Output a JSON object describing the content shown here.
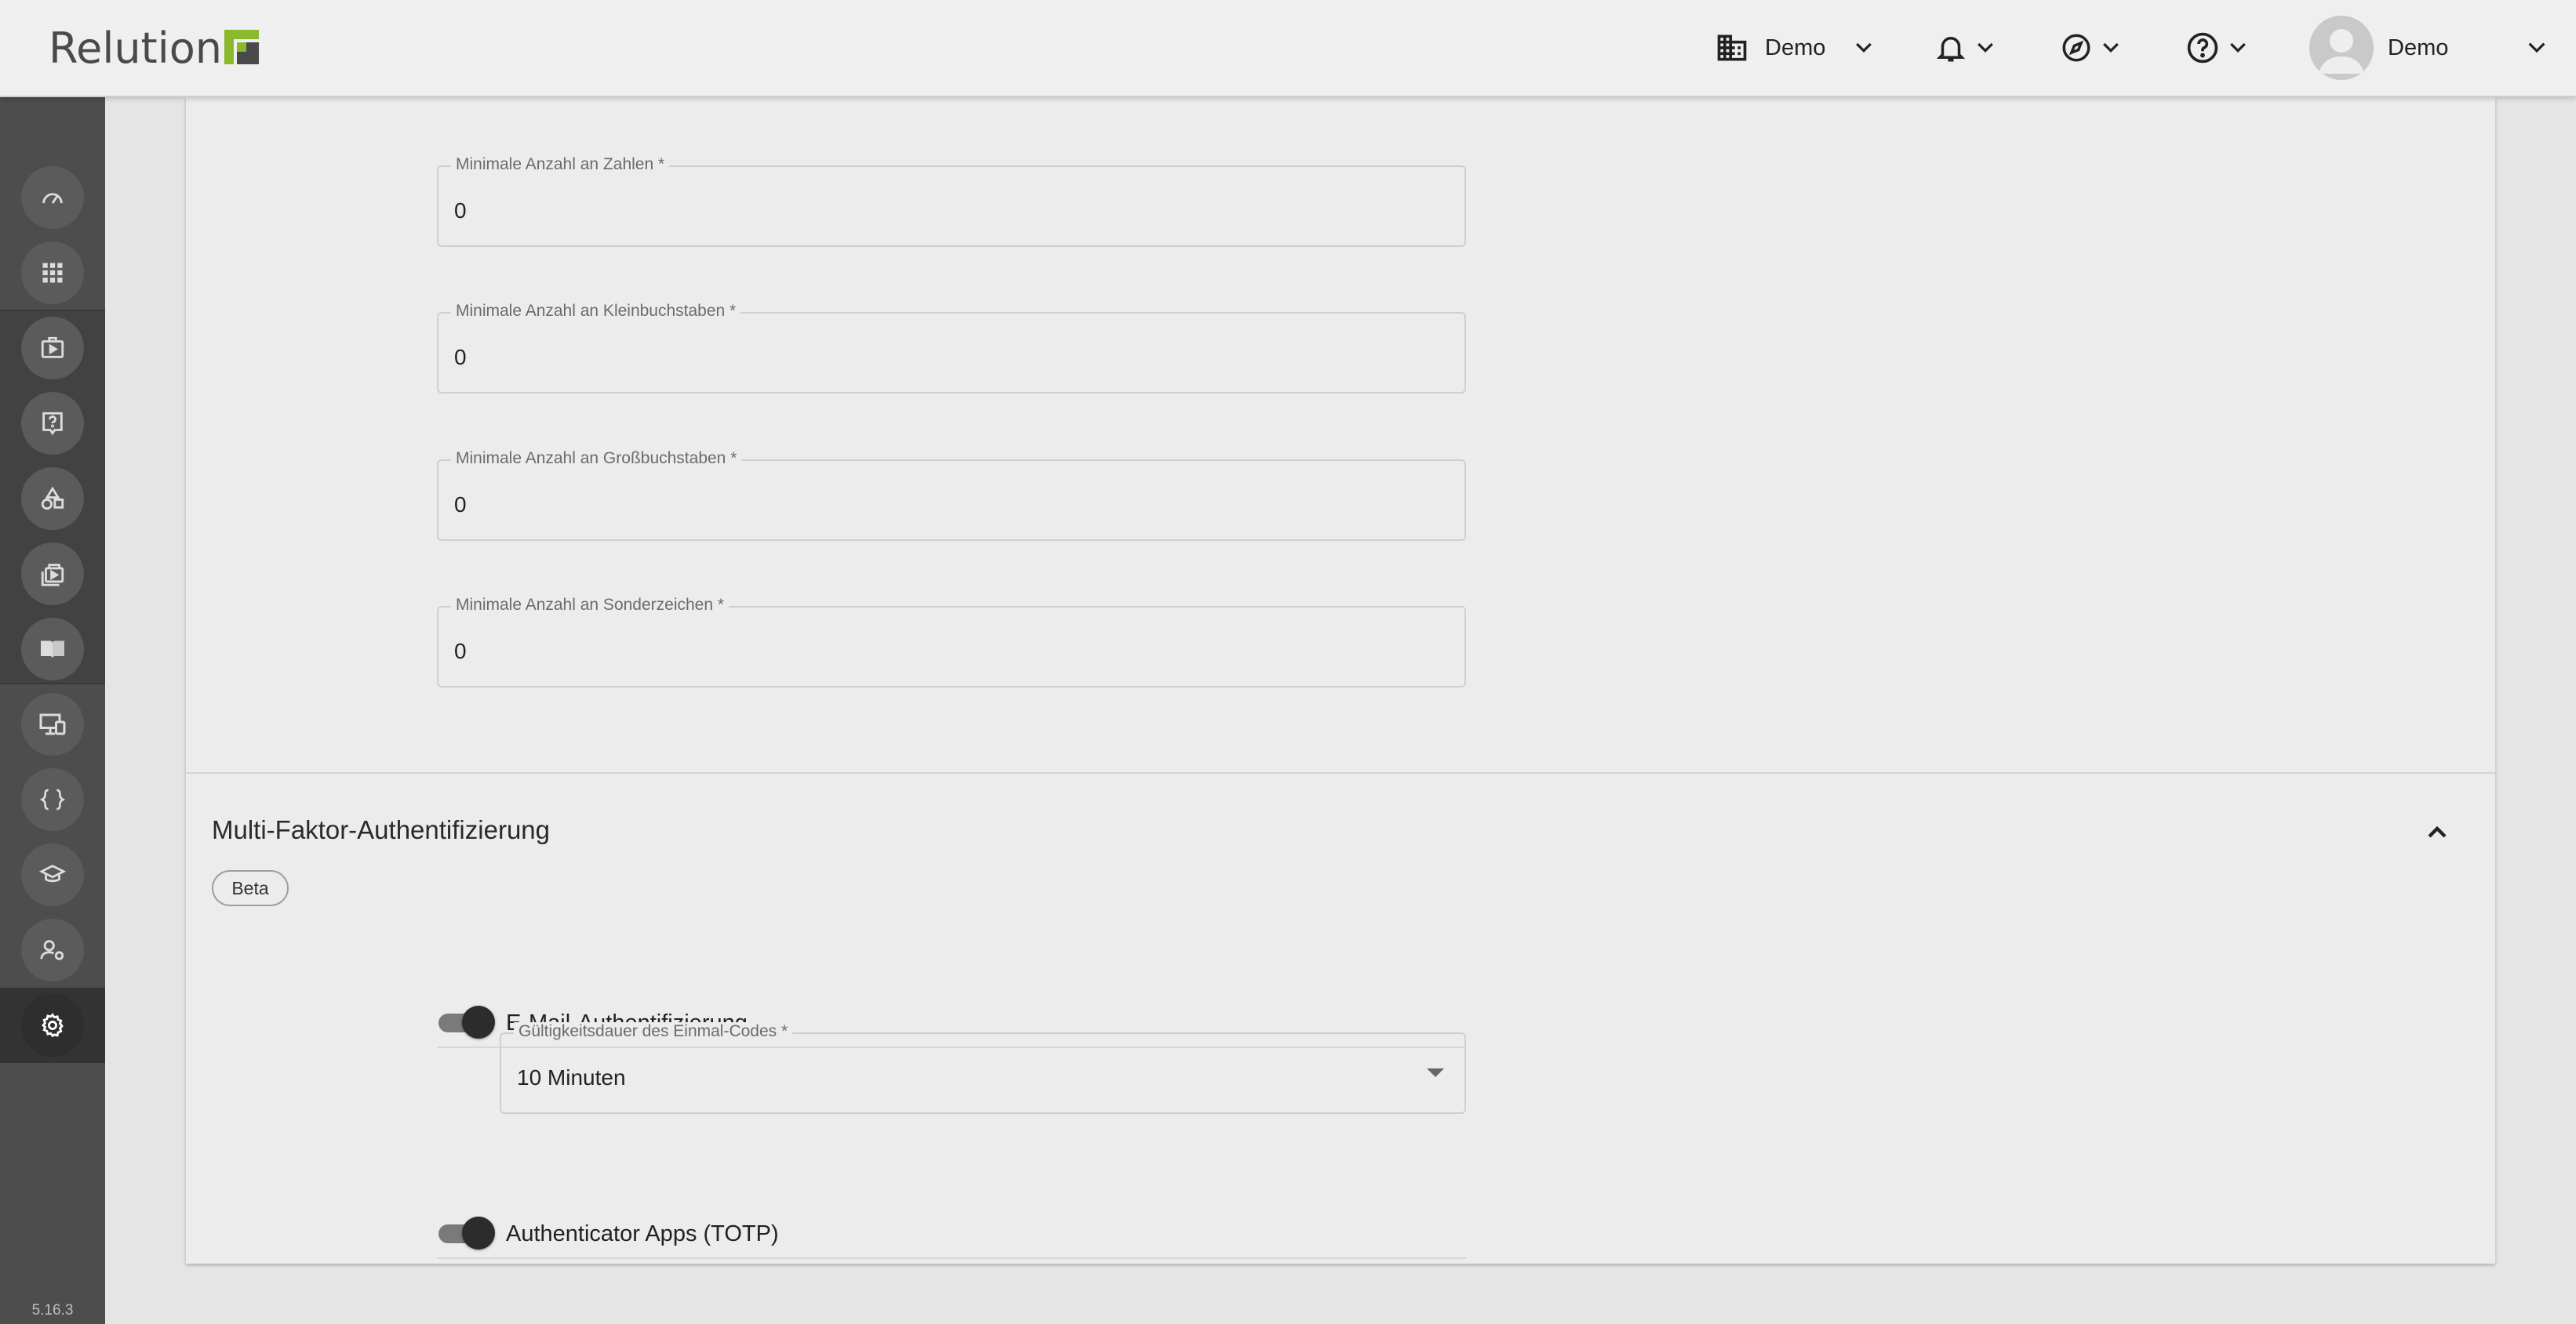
{
  "header": {
    "logo_text": "Relution",
    "tenant_label": "Demo",
    "user_label": "Demo",
    "brand_colors": {
      "logo_green": "#8cb82b",
      "logo_dark": "#4a4a4a"
    }
  },
  "sidebar": {
    "items": [
      {
        "icon": "dashboard-icon"
      },
      {
        "icon": "apps-grid-icon"
      },
      {
        "icon": "app-store-icon"
      },
      {
        "icon": "help-request-icon"
      },
      {
        "icon": "shapes-icon"
      },
      {
        "icon": "content-library-icon"
      },
      {
        "icon": "book-icon"
      },
      {
        "icon": "devices-icon"
      },
      {
        "icon": "code-braces-icon"
      },
      {
        "icon": "education-icon"
      },
      {
        "icon": "user-settings-icon"
      },
      {
        "icon": "settings-gear-icon",
        "active": true
      }
    ],
    "version": "5.16.3"
  },
  "password_policy": {
    "fields": [
      {
        "label": "Minimale Anzahl an Zahlen *",
        "value": "0"
      },
      {
        "label": "Minimale Anzahl an Kleinbuchstaben *",
        "value": "0"
      },
      {
        "label": "Minimale Anzahl an Großbuchstaben *",
        "value": "0"
      },
      {
        "label": "Minimale Anzahl an Sonderzeichen *",
        "value": "0"
      }
    ]
  },
  "mfa": {
    "title": "Multi-Faktor-Authentifizierung",
    "badge": "Beta",
    "email_toggle": {
      "label": "E-Mail-Authentifizierung",
      "enabled": true
    },
    "code_validity": {
      "label": "Gültigkeitsdauer des Einmal-Codes *",
      "value": "10 Minuten"
    },
    "totp_toggle": {
      "label": "Authenticator Apps (TOTP)",
      "enabled": true
    }
  }
}
